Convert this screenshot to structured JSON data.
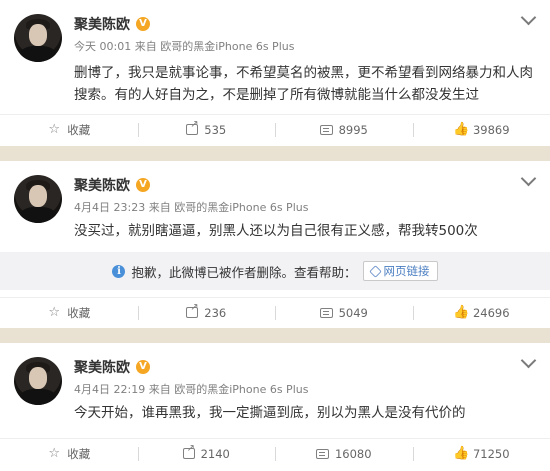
{
  "posts": [
    {
      "author": "聚美陈欧",
      "verified_badge": "V",
      "time": "今天 00:01",
      "from_label": "来自",
      "device": "欧哥的黑金iPhone 6s Plus",
      "text": "删博了，我只是就事论事，不希望莫名的被黑，更不希望看到网络暴力和人肉搜索。有的人好自为之，不是删掉了所有微博就能当什么都没发生过",
      "actions": {
        "favorite": "收藏",
        "repost": "535",
        "comment": "8995",
        "like": "39869"
      }
    },
    {
      "author": "聚美陈欧",
      "verified_badge": "V",
      "time": "4月4日 23:23",
      "from_label": "来自",
      "device": "欧哥的黑金iPhone 6s Plus",
      "text": "没买过，就别瞎逼逼，别黑人还以为自己很有正义感，帮我转500次",
      "deleted_notice": {
        "info_glyph": "i",
        "message": "抱歉，此微博已被作者删除。查看帮助：",
        "link_label": "网页链接"
      },
      "actions": {
        "favorite": "收藏",
        "repost": "236",
        "comment": "5049",
        "like": "24696"
      }
    },
    {
      "author": "聚美陈欧",
      "verified_badge": "V",
      "time": "4月4日 22:19",
      "from_label": "来自",
      "device": "欧哥的黑金iPhone 6s Plus",
      "text": "今天开始，谁再黑我，我一定撕逼到底，别以为黑人是没有代价的",
      "actions": {
        "favorite": "收藏",
        "repost": "2140",
        "comment": "16080",
        "like": "71250"
      }
    }
  ],
  "icons": {
    "favorite": "star-icon",
    "repost": "share-icon",
    "comment": "comment-icon",
    "like": "thumbs-up-icon",
    "menu": "chevron-down-icon"
  },
  "colors": {
    "background": "#e9e2d3",
    "verified": "#f5a623",
    "link": "#4a7ec1",
    "info": "#4a90d9"
  }
}
